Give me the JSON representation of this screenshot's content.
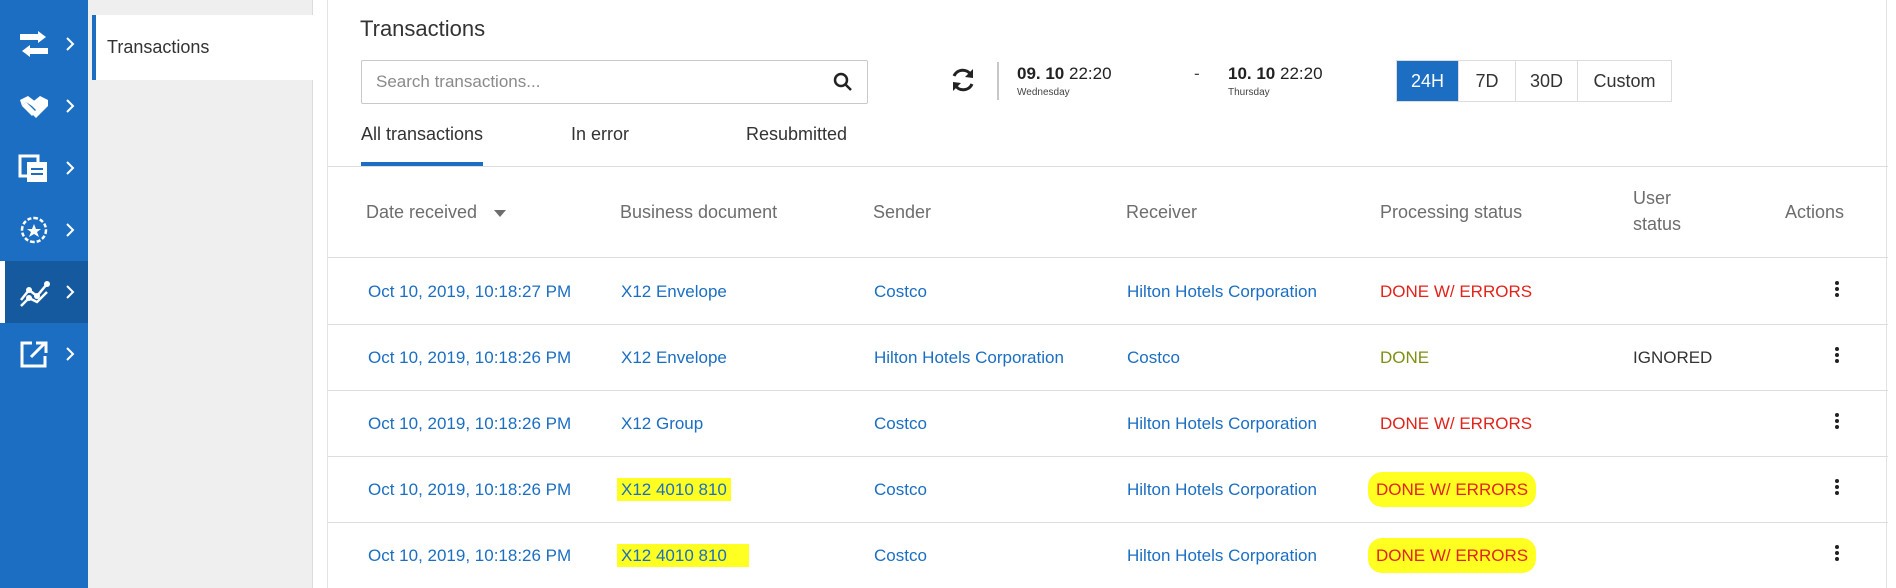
{
  "rail": {
    "items": [
      {
        "icon": "transfer-arrows-icon",
        "active": false
      },
      {
        "icon": "handshake-icon",
        "active": false
      },
      {
        "icon": "documents-icon",
        "active": false
      },
      {
        "icon": "process-cycle-icon",
        "active": false
      },
      {
        "icon": "analytics-graph-icon",
        "active": true
      },
      {
        "icon": "external-link-icon",
        "active": false
      }
    ]
  },
  "submenu": {
    "items": [
      {
        "label": "Transactions"
      }
    ]
  },
  "page": {
    "title": "Transactions"
  },
  "search": {
    "placeholder": "Search transactions..."
  },
  "daterange": {
    "from_date": "09. 10",
    "from_time": "22:20",
    "from_day": "Wednesday",
    "separator": "-",
    "to_date": "10. 10",
    "to_time": "22:20",
    "to_day": "Thursday"
  },
  "range_buttons": [
    {
      "label": "24H",
      "active": true
    },
    {
      "label": "7D",
      "active": false
    },
    {
      "label": "30D",
      "active": false
    },
    {
      "label": "Custom",
      "active": false
    }
  ],
  "tabs": [
    {
      "label": "All transactions",
      "active": true
    },
    {
      "label": "In error",
      "active": false
    },
    {
      "label": "Resubmitted",
      "active": false
    }
  ],
  "table": {
    "columns": {
      "date_received": "Date received",
      "business_document": "Business document",
      "sender": "Sender",
      "receiver": "Receiver",
      "processing_status": "Processing status",
      "user_status_line1": "User",
      "user_status_line2": "status",
      "actions": "Actions"
    },
    "rows": [
      {
        "date": "Oct 10, 2019, 10:18:27 PM",
        "document": "X12 Envelope",
        "sender": "Costco",
        "receiver": "Hilton Hotels Corporation",
        "status": "DONE W/ ERRORS",
        "user_status": "",
        "highlighted": false
      },
      {
        "date": "Oct 10, 2019, 10:18:26 PM",
        "document": "X12 Envelope",
        "sender": "Hilton Hotels Corporation",
        "receiver": "Costco",
        "status": "DONE",
        "user_status": "IGNORED",
        "highlighted": false
      },
      {
        "date": "Oct 10, 2019, 10:18:26 PM",
        "document": "X12 Group",
        "sender": "Costco",
        "receiver": "Hilton Hotels Corporation",
        "status": "DONE W/ ERRORS",
        "user_status": "",
        "highlighted": false
      },
      {
        "date": "Oct 10, 2019, 10:18:26 PM",
        "document": "X12 4010 810",
        "sender": "Costco",
        "receiver": "Hilton Hotels Corporation",
        "status": "DONE W/ ERRORS",
        "user_status": "",
        "highlighted": true
      },
      {
        "date": "Oct 10, 2019, 10:18:26 PM",
        "document": "X12 4010 810",
        "sender": "Costco",
        "receiver": "Hilton Hotels Corporation",
        "status": "DONE W/ ERRORS",
        "user_status": "",
        "highlighted": true
      }
    ]
  },
  "colors": {
    "brand_blue": "#1b6ec2",
    "error_red": "#e2231a",
    "done_olive": "#7f8f12",
    "highlight_yellow": "#ffff22"
  }
}
